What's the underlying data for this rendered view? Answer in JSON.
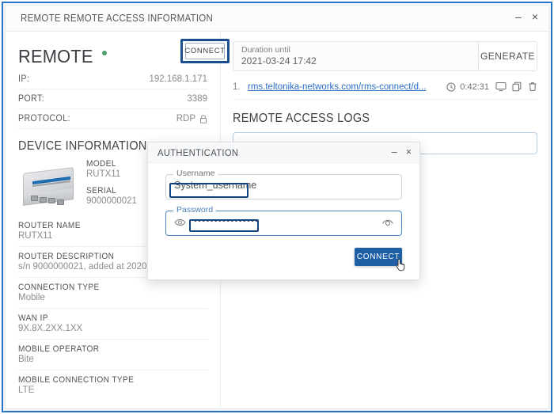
{
  "window": {
    "title": "REMOTE REMOTE ACCESS INFORMATION",
    "minimize_label": "–",
    "close_label": "×"
  },
  "device": {
    "name": "REMOTE",
    "status_color": "#4c9e6b",
    "rows": [
      {
        "key": "IP:",
        "value": "192.168.1.171"
      },
      {
        "key": "PORT:",
        "value": "3389"
      },
      {
        "key": "PROTOCOL:",
        "value": "RDP"
      }
    ],
    "protocol_icon": "lock-icon"
  },
  "device_information": {
    "section_title": "DEVICE INFORMATION",
    "image_alt": "router-device-image",
    "model_label": "MODEL",
    "model_value": "RUTX11",
    "serial_label": "SERIAL",
    "serial_value": "9000000021",
    "fields": [
      {
        "label": "ROUTER NAME",
        "value": "RUTX11"
      },
      {
        "label": "ROUTER DESCRIPTION",
        "value": "s/n 9000000021, added at 2020"
      },
      {
        "label": "CONNECTION TYPE",
        "value": "Mobile"
      },
      {
        "label": "WAN IP",
        "value": "9X.8X.2XX.1XX"
      },
      {
        "label": "MOBILE OPERATOR",
        "value": "Bite"
      },
      {
        "label": "MOBILE CONNECTION TYPE",
        "value": "LTE"
      }
    ]
  },
  "connect_top": {
    "label": "CONNECT"
  },
  "duration": {
    "label": "Duration until",
    "value": "2021-03-24 17:42",
    "generate_label": "GENERATE"
  },
  "session": {
    "index": "1.",
    "url": "rms.teltonika-networks.com/rms-connect/d...",
    "clock_icon": "clock-icon",
    "time": "0:42:31",
    "icons": [
      "monitor-icon",
      "copy-icon",
      "trash-icon"
    ]
  },
  "logs": {
    "title": "REMOTE ACCESS LOGS"
  },
  "auth_dialog": {
    "title": "AUTHENTICATION",
    "minimize_label": "–",
    "close_label": "×",
    "username": {
      "label": "Username",
      "value": "System_username"
    },
    "password": {
      "label": "Password",
      "value": "••••••••••••••••",
      "left_icon": "eye-icon",
      "right_icon": "eye-toggle-icon"
    },
    "connect_label": "CONNECT"
  },
  "colors": {
    "annotation": "#12457f",
    "accent_blue": "#1f5fa6",
    "link": "#2b6ec4"
  }
}
